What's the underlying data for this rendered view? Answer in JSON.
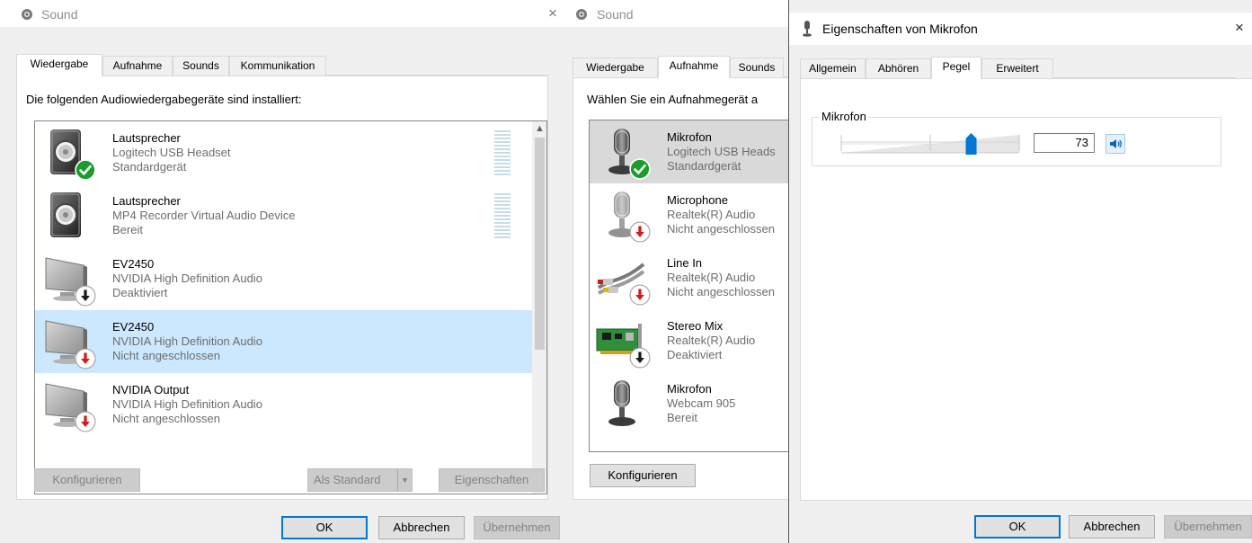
{
  "sound_playback": {
    "title": "Sound",
    "close": "×",
    "tabs": [
      "Wiedergabe",
      "Aufnahme",
      "Sounds",
      "Kommunikation"
    ],
    "heading": "Die folgenden Audiowiedergabegeräte sind installiert:",
    "devices": [
      {
        "name": "Lautsprecher",
        "driver": "Logitech USB Headset",
        "status": "Standardgerät",
        "icon": "speaker-icon",
        "badge": "default-check-badge"
      },
      {
        "name": "Lautsprecher",
        "driver": "MP4 Recorder Virtual Audio Device",
        "status": "Bereit",
        "icon": "speaker-icon",
        "badge": ""
      },
      {
        "name": "EV2450",
        "driver": "NVIDIA High Definition Audio",
        "status": "Deaktiviert",
        "icon": "monitor-icon",
        "badge": "disabled-arrow-badge"
      },
      {
        "name": "EV2450",
        "driver": "NVIDIA High Definition Audio",
        "status": "Nicht angeschlossen",
        "icon": "monitor-icon",
        "badge": "unplugged-arrow-badge"
      },
      {
        "name": "NVIDIA Output",
        "driver": "NVIDIA High Definition Audio",
        "status": "Nicht angeschlossen",
        "icon": "monitor-icon",
        "badge": "unplugged-arrow-badge"
      }
    ],
    "buttons": {
      "configure": "Konfigurieren",
      "set_default": "Als Standard",
      "properties": "Eigenschaften"
    },
    "dialog": {
      "ok": "OK",
      "cancel": "Abbrechen",
      "apply": "Übernehmen"
    }
  },
  "sound_recording": {
    "title": "Sound",
    "tabs": [
      "Wiedergabe",
      "Aufnahme",
      "Sounds"
    ],
    "heading": "Wählen Sie ein Aufnahmegerät a",
    "devices": [
      {
        "name": "Mikrofon",
        "driver": "Logitech USB Heads",
        "status": "Standardgerät",
        "icon": "microphone-icon",
        "badge": "default-check-badge"
      },
      {
        "name": "Microphone",
        "driver": "Realtek(R) Audio",
        "status": "Nicht angeschlossen",
        "icon": "microphone-icon",
        "badge": "unplugged-arrow-badge"
      },
      {
        "name": "Line In",
        "driver": "Realtek(R) Audio",
        "status": "Nicht angeschlossen",
        "icon": "line-in-cable-icon",
        "badge": "unplugged-arrow-badge"
      },
      {
        "name": "Stereo Mix",
        "driver": "Realtek(R) Audio",
        "status": "Deaktiviert",
        "icon": "sound-card-icon",
        "badge": "disabled-arrow-badge"
      },
      {
        "name": "Mikrofon",
        "driver": "Webcam 905",
        "status": "Bereit",
        "icon": "microphone-icon",
        "badge": ""
      }
    ],
    "buttons": {
      "configure": "Konfigurieren"
    }
  },
  "mic_properties": {
    "title": "Eigenschaften von Mikrofon",
    "close": "×",
    "tabs": [
      "Allgemein",
      "Abhören",
      "Pegel",
      "Erweitert"
    ],
    "group_label": "Mikrofon",
    "level": {
      "value": "73",
      "fraction": 0.73
    },
    "dialog": {
      "ok": "OK",
      "cancel": "Abbrechen",
      "apply": "Übernehmen"
    }
  },
  "colors": {
    "accent": "#0078d7",
    "selection": "#cce8ff",
    "check_green": "#1a9e2b",
    "unplugged_red": "#d21b1b"
  }
}
